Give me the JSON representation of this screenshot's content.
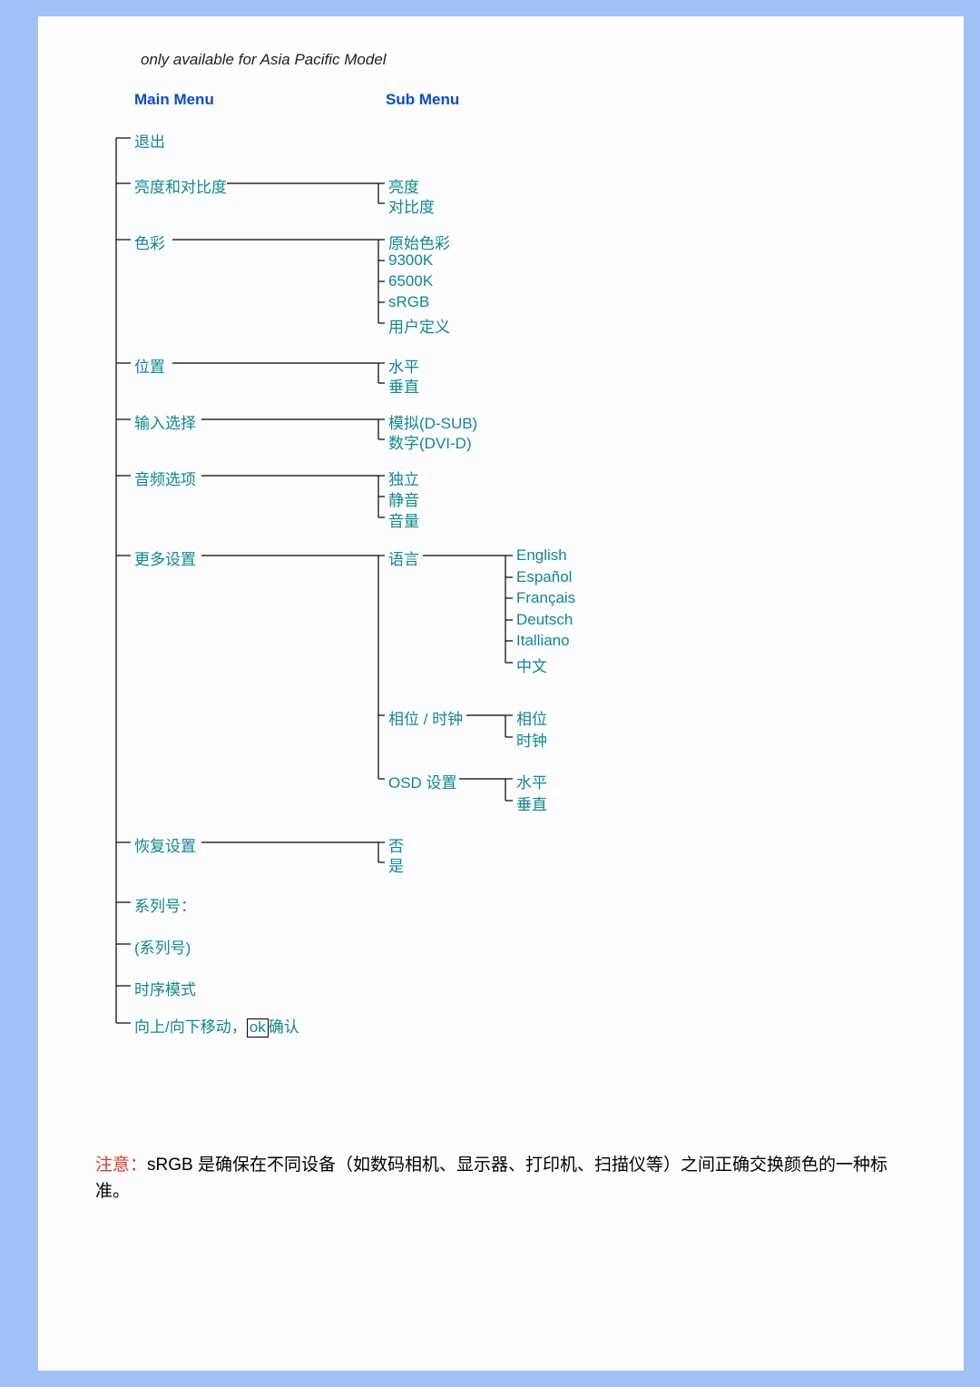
{
  "subtitle": "only available for Asia Pacific Model",
  "headers": {
    "main": "Main Menu",
    "sub": "Sub Menu"
  },
  "main": {
    "exit": "退出",
    "brightness_contrast": "亮度和对比度",
    "color": "色彩",
    "position": "位置",
    "input": "输入选择",
    "audio": "音频选项",
    "more": "更多设置",
    "reset": "恢复设置",
    "serial_label": "系列号：",
    "serial_value": "(系列号)",
    "timing": "时序模式",
    "nav_pre": "向上/向下移动，",
    "nav_ok": "ok",
    "nav_post": "确认"
  },
  "sub": {
    "brightness": "亮度",
    "contrast": "对比度",
    "color_original": "原始色彩",
    "color_9300": "9300K",
    "color_6500": "6500K",
    "color_srgb": "sRGB",
    "color_user": "用户定义",
    "pos_h": "水平",
    "pos_v": "垂直",
    "input_analog": "模拟(D-SUB)",
    "input_digital": "数字(DVI-D)",
    "audio_ind": "独立",
    "audio_mute": "静音",
    "audio_vol": "音量",
    "lang": "语言",
    "phase_clock": "相位 / 时钟",
    "osd": "OSD 设置",
    "reset_no": "否",
    "reset_yes": "是"
  },
  "third": {
    "lang_en": "English",
    "lang_es": "Español",
    "lang_fr": "Français",
    "lang_de": "Deutsch",
    "lang_it": "Italliano",
    "lang_zh": "中文",
    "phase": "相位",
    "clock": "时钟",
    "osd_h": "水平",
    "osd_v": "垂直"
  },
  "note": {
    "label": "注意：",
    "text": "sRGB 是确保在不同设备（如数码相机、显示器、打印机、扫描仪等）之间正确交换颜色的一种标准。"
  }
}
